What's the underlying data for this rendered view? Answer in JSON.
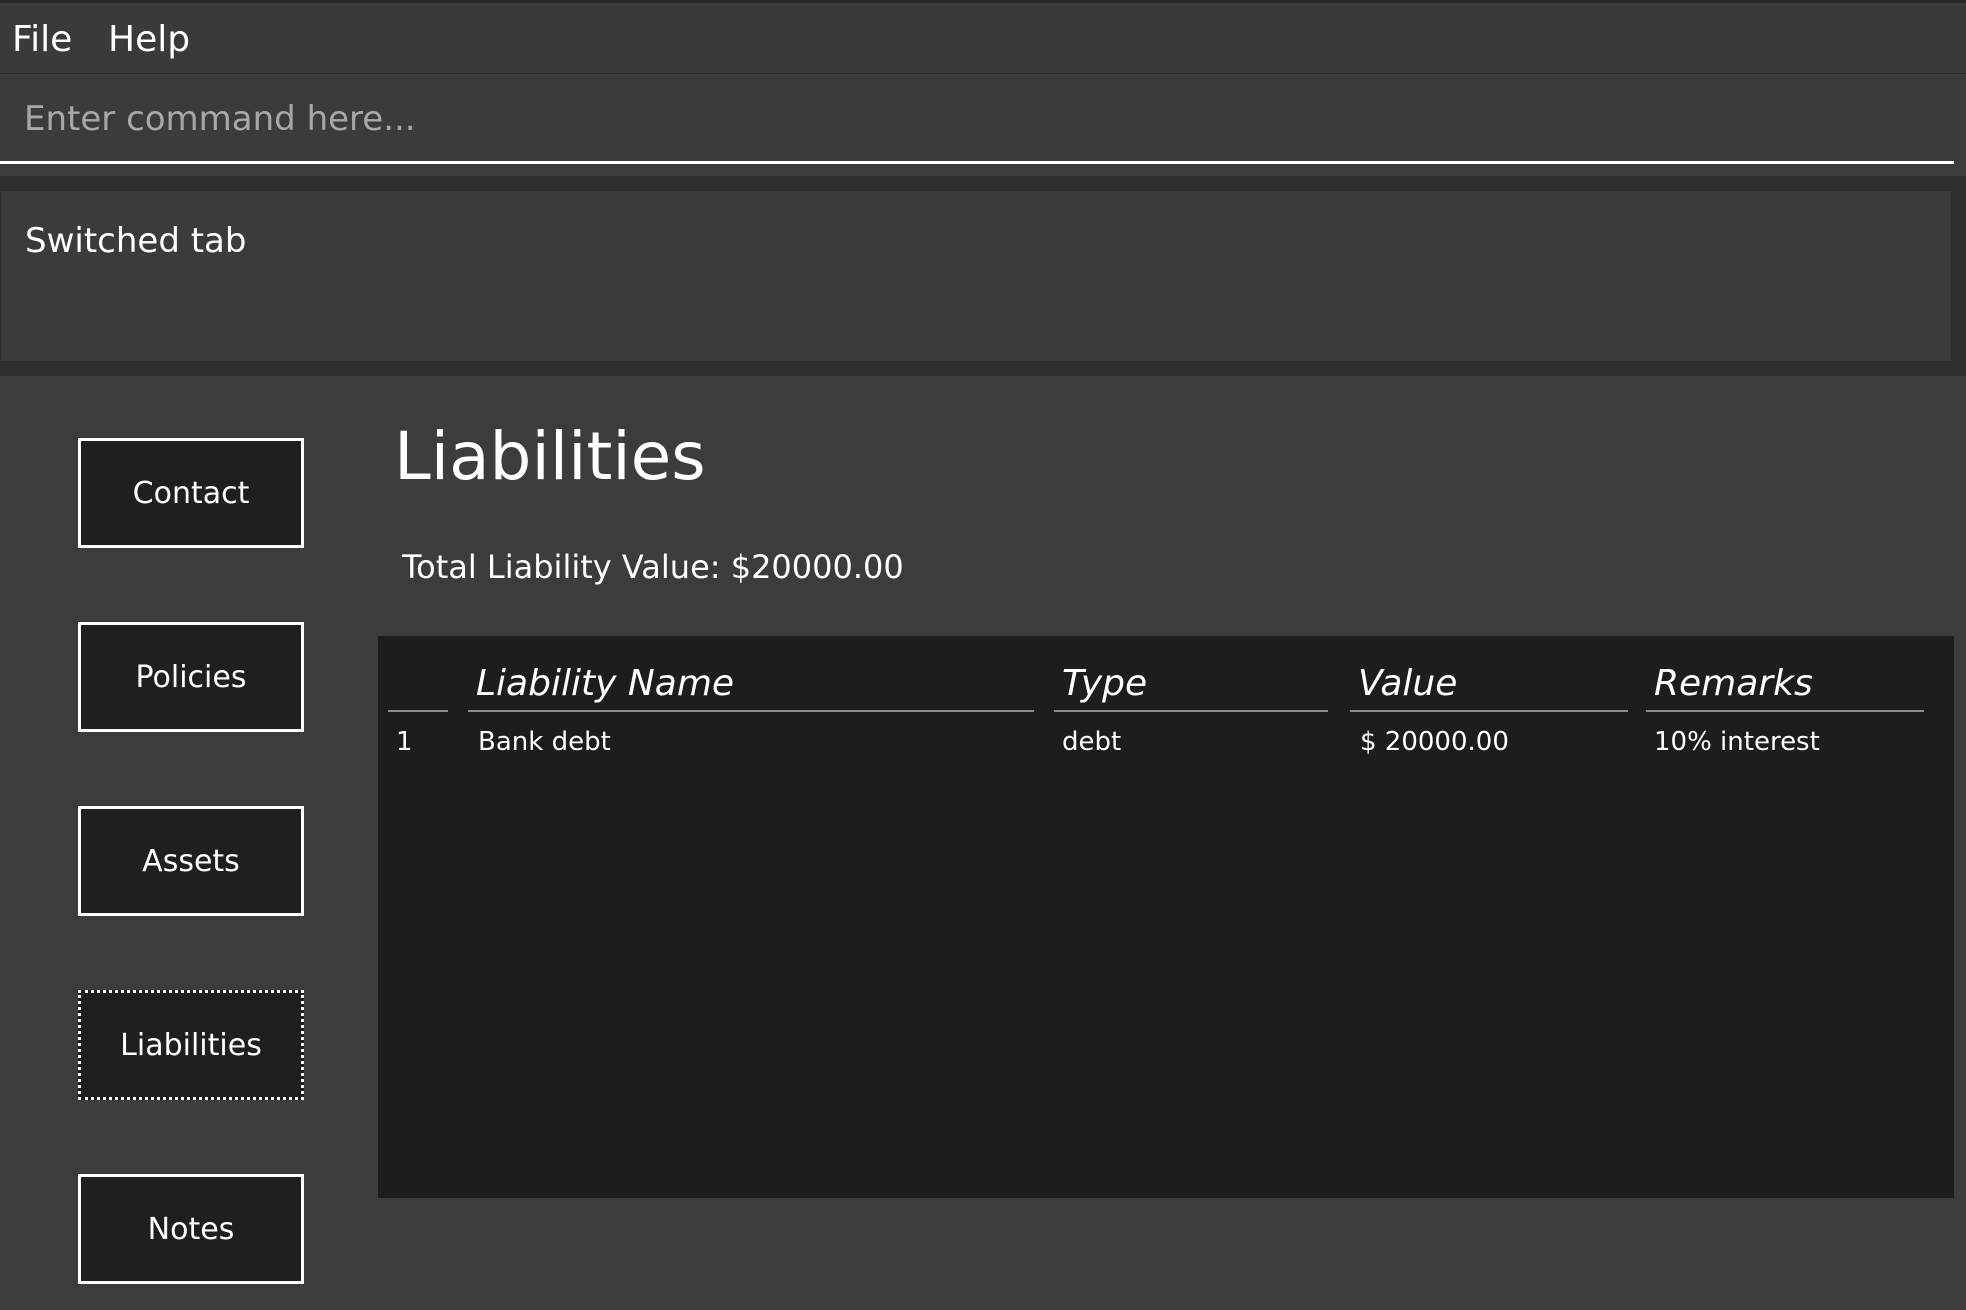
{
  "menu": {
    "file_label": "File",
    "help_label": "Help"
  },
  "command": {
    "placeholder": "Enter command here...",
    "value": ""
  },
  "result": {
    "message": "Switched tab"
  },
  "nav": {
    "contact_label": "Contact",
    "policies_label": "Policies",
    "assets_label": "Assets",
    "liabilities_label": "Liabilities",
    "notes_label": "Notes",
    "active": "Liabilities"
  },
  "page": {
    "title": "Liabilities",
    "total_label": "Total Liability Value: $20000.00"
  },
  "table": {
    "columns": {
      "index": "",
      "name": "Liability Name",
      "type": "Type",
      "value": "Value",
      "remarks": "Remarks"
    },
    "rows": [
      {
        "index": "1",
        "name": "Bank debt",
        "type": "debt",
        "value": "$ 20000.00",
        "remarks": "10% interest"
      }
    ]
  }
}
